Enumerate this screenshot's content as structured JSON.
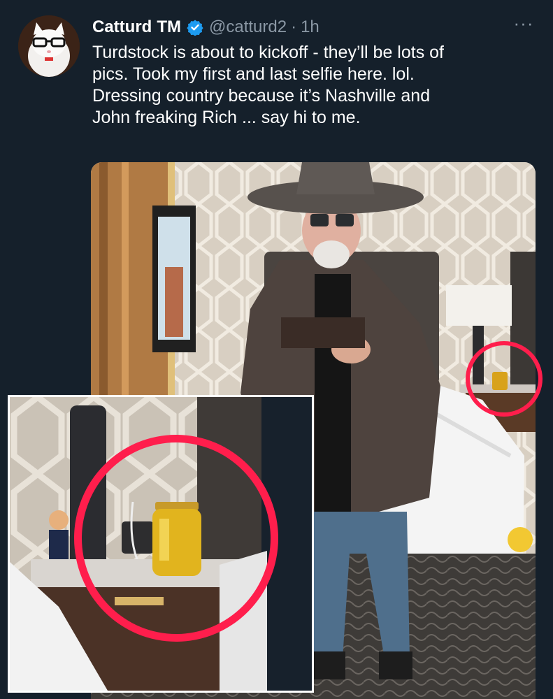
{
  "tweet": {
    "author": {
      "display_name": "Catturd",
      "tm": "TM",
      "handle": "@catturd2",
      "separator": "·",
      "time": "1h",
      "verified": true
    },
    "more_menu": "···",
    "text_lines": [
      "Turdstock is about to kickoff - they’ll be lots of",
      "pics. Took my first and last selfie here. lol.",
      "Dressing country because it’s Nashville and",
      "John freaking Rich ... say hi to me."
    ]
  },
  "icons": {
    "verified": "verified-badge-icon",
    "more": "more-options-icon"
  },
  "colors": {
    "background": "#15202b",
    "text": "#ffffff",
    "muted": "#8b98a5",
    "verified_blue": "#1d9bf0",
    "highlight_circle": "#ff1e4c"
  }
}
